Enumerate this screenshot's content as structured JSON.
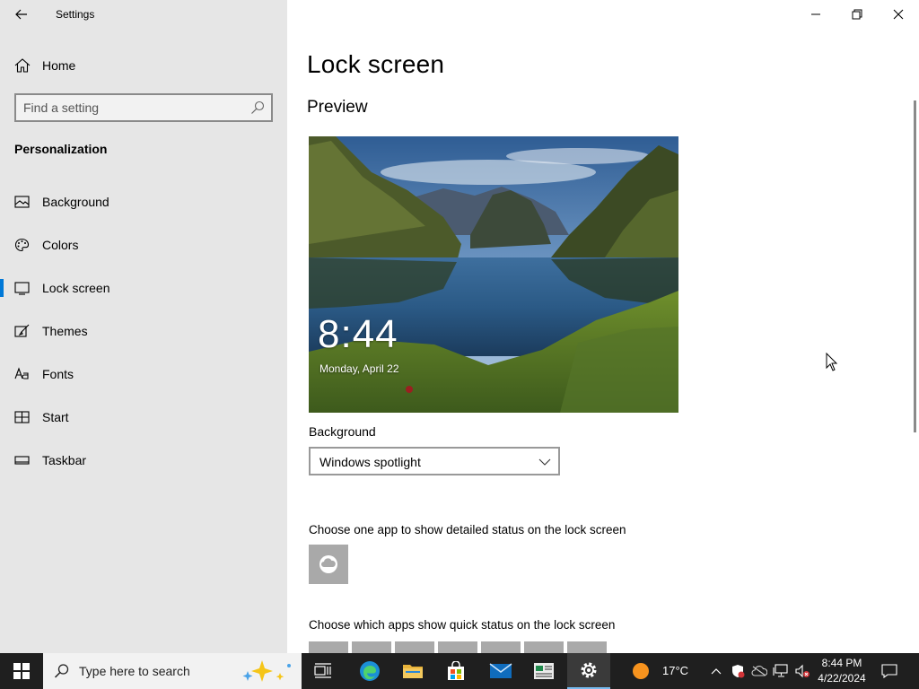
{
  "window": {
    "title": "Settings",
    "minimize_icon": "minimize-icon",
    "restore_icon": "restore-icon",
    "close_icon": "close-icon"
  },
  "sidebar": {
    "home_label": "Home",
    "search_placeholder": "Find a setting",
    "section_heading": "Personalization",
    "items": [
      {
        "label": "Background",
        "icon": "picture-icon",
        "selected": false
      },
      {
        "label": "Colors",
        "icon": "palette-icon",
        "selected": false
      },
      {
        "label": "Lock screen",
        "icon": "lock-screen-icon",
        "selected": true
      },
      {
        "label": "Themes",
        "icon": "brush-icon",
        "selected": false
      },
      {
        "label": "Fonts",
        "icon": "font-icon",
        "selected": false
      },
      {
        "label": "Start",
        "icon": "start-icon",
        "selected": false
      },
      {
        "label": "Taskbar",
        "icon": "taskbar-icon",
        "selected": false
      }
    ]
  },
  "main": {
    "title": "Lock screen",
    "preview_heading": "Preview",
    "preview_time": "8:44",
    "preview_date": "Monday, April 22",
    "background_label": "Background",
    "background_value": "Windows spotlight",
    "detailed_status_label": "Choose one app to show detailed status on the lock screen",
    "quick_status_label": "Choose which apps show quick status on the lock screen"
  },
  "taskbar": {
    "search_text": "Type here to search",
    "temperature": "17°C",
    "time": "8:44 PM",
    "date": "4/22/2024",
    "accent": "#76b9ed"
  },
  "colors": {
    "accent": "#0078d7",
    "sidebar_bg": "#e6e6e6",
    "taskbar_bg": "#1f1f1f"
  }
}
